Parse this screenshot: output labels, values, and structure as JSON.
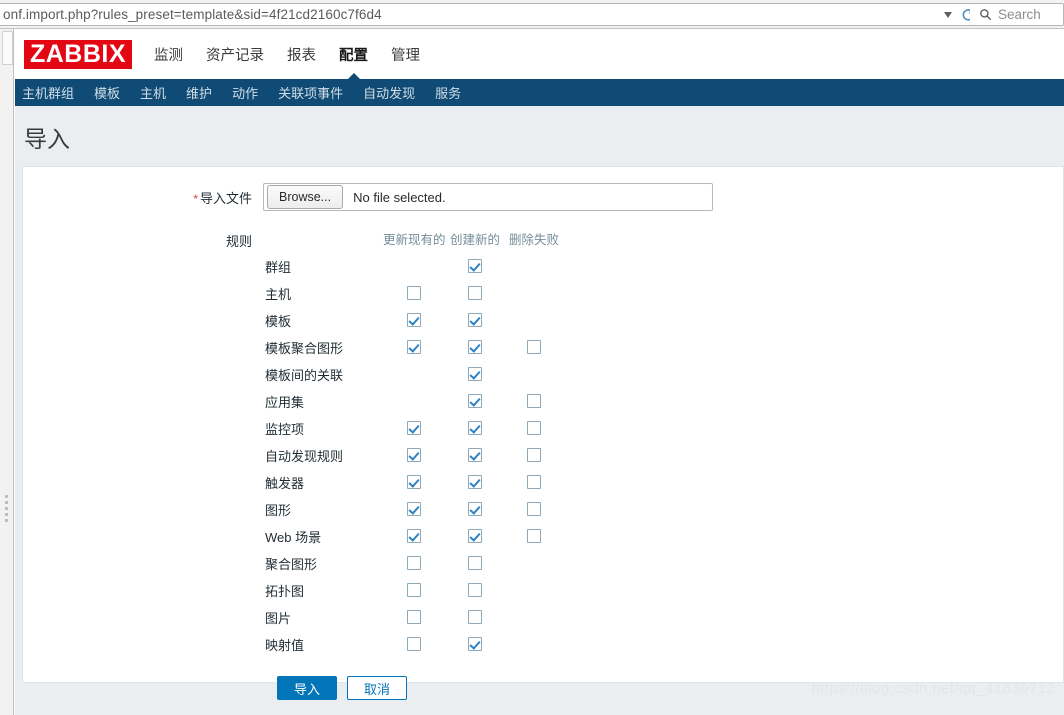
{
  "browser": {
    "url": "onf.import.php?rules_preset=template&sid=4f21cd2160c7f6d4",
    "dropdown_icon": "chevron-down-icon",
    "reload_icon": "reload-icon",
    "search_icon": "search-icon",
    "search_placeholder": "Search"
  },
  "app": {
    "logo_text": "ZABBIX",
    "logo_color": "#e30613",
    "accent_color": "#0f4b75",
    "primary_button_color": "#0275b8",
    "topnav": [
      {
        "label": "监测",
        "active": false
      },
      {
        "label": "资产记录",
        "active": false
      },
      {
        "label": "报表",
        "active": false
      },
      {
        "label": "配置",
        "active": true
      },
      {
        "label": "管理",
        "active": false
      }
    ],
    "subnav": [
      {
        "label": "主机群组"
      },
      {
        "label": "模板"
      },
      {
        "label": "主机"
      },
      {
        "label": "维护"
      },
      {
        "label": "动作"
      },
      {
        "label": "关联项事件"
      },
      {
        "label": "自动发现"
      },
      {
        "label": "服务"
      }
    ]
  },
  "page": {
    "title": "导入",
    "file_field": {
      "required_mark": "*",
      "label": "导入文件",
      "browse_label": "Browse...",
      "status_text": "No file selected."
    },
    "rules": {
      "label": "规则",
      "columns": [
        "更新现有的",
        "创建新的",
        "删除失败"
      ],
      "rows": [
        {
          "label": "群组",
          "update": null,
          "create": true,
          "delete": null
        },
        {
          "label": "主机",
          "update": false,
          "create": false,
          "delete": null
        },
        {
          "label": "模板",
          "update": true,
          "create": true,
          "delete": null
        },
        {
          "label": "模板聚合图形",
          "update": true,
          "create": true,
          "delete": false
        },
        {
          "label": "模板间的关联",
          "update": null,
          "create": true,
          "delete": null
        },
        {
          "label": "应用集",
          "update": null,
          "create": true,
          "delete": false
        },
        {
          "label": "监控项",
          "update": true,
          "create": true,
          "delete": false
        },
        {
          "label": "自动发现规则",
          "update": true,
          "create": true,
          "delete": false
        },
        {
          "label": "触发器",
          "update": true,
          "create": true,
          "delete": false
        },
        {
          "label": "图形",
          "update": true,
          "create": true,
          "delete": false
        },
        {
          "label": "Web 场景",
          "update": true,
          "create": true,
          "delete": false
        },
        {
          "label": "聚合图形",
          "update": false,
          "create": false,
          "delete": null
        },
        {
          "label": "拓扑图",
          "update": false,
          "create": false,
          "delete": null
        },
        {
          "label": "图片",
          "update": false,
          "create": false,
          "delete": null
        },
        {
          "label": "映射值",
          "update": false,
          "create": true,
          "delete": null
        }
      ]
    },
    "buttons": {
      "submit_label": "导入",
      "cancel_label": "取消"
    },
    "watermark": "https://blog.csdn.net/qq_41830712"
  }
}
